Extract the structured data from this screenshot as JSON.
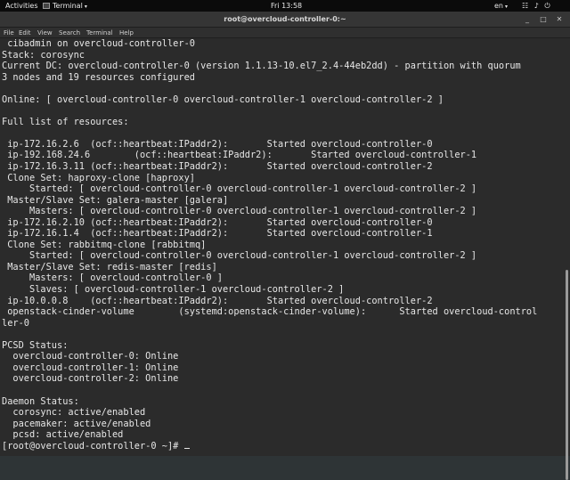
{
  "topbar": {
    "activities": "Activities",
    "app_name": "Terminal",
    "clock": "Fri 13:58",
    "language": "en",
    "system_icons": "☷ ♪ ⏻"
  },
  "window": {
    "title": "root@overcloud-controller-0:~",
    "menu": [
      "File",
      "Edit",
      "View",
      "Search",
      "Terminal",
      "Help"
    ]
  },
  "terminal": {
    "lines": [
      " cibadmin on overcloud-controller-0",
      "Stack: corosync",
      "Current DC: overcloud-controller-0 (version 1.1.13-10.el7_2.4-44eb2dd) - partition with quorum",
      "3 nodes and 19 resources configured",
      "",
      "Online: [ overcloud-controller-0 overcloud-controller-1 overcloud-controller-2 ]",
      "",
      "Full list of resources:",
      "",
      " ip-172.16.2.6  (ocf::heartbeat:IPaddr2):       Started overcloud-controller-0",
      " ip-192.168.24.6        (ocf::heartbeat:IPaddr2):       Started overcloud-controller-1",
      " ip-172.16.3.11 (ocf::heartbeat:IPaddr2):       Started overcloud-controller-2",
      " Clone Set: haproxy-clone [haproxy]",
      "     Started: [ overcloud-controller-0 overcloud-controller-1 overcloud-controller-2 ]",
      " Master/Slave Set: galera-master [galera]",
      "     Masters: [ overcloud-controller-0 overcloud-controller-1 overcloud-controller-2 ]",
      " ip-172.16.2.10 (ocf::heartbeat:IPaddr2):       Started overcloud-controller-0",
      " ip-172.16.1.4  (ocf::heartbeat:IPaddr2):       Started overcloud-controller-1",
      " Clone Set: rabbitmq-clone [rabbitmq]",
      "     Started: [ overcloud-controller-0 overcloud-controller-1 overcloud-controller-2 ]",
      " Master/Slave Set: redis-master [redis]",
      "     Masters: [ overcloud-controller-0 ]",
      "     Slaves: [ overcloud-controller-1 overcloud-controller-2 ]",
      " ip-10.0.0.8    (ocf::heartbeat:IPaddr2):       Started overcloud-controller-2",
      " openstack-cinder-volume        (systemd:openstack-cinder-volume):      Started overcloud-control",
      "ler-0",
      "",
      "PCSD Status:",
      "  overcloud-controller-0: Online",
      "  overcloud-controller-1: Online",
      "  overcloud-controller-2: Online",
      "",
      "Daemon Status:",
      "  corosync: active/enabled",
      "  pacemaker: active/enabled",
      "  pcsd: active/enabled"
    ],
    "prompt": "[root@overcloud-controller-0 ~]# "
  }
}
